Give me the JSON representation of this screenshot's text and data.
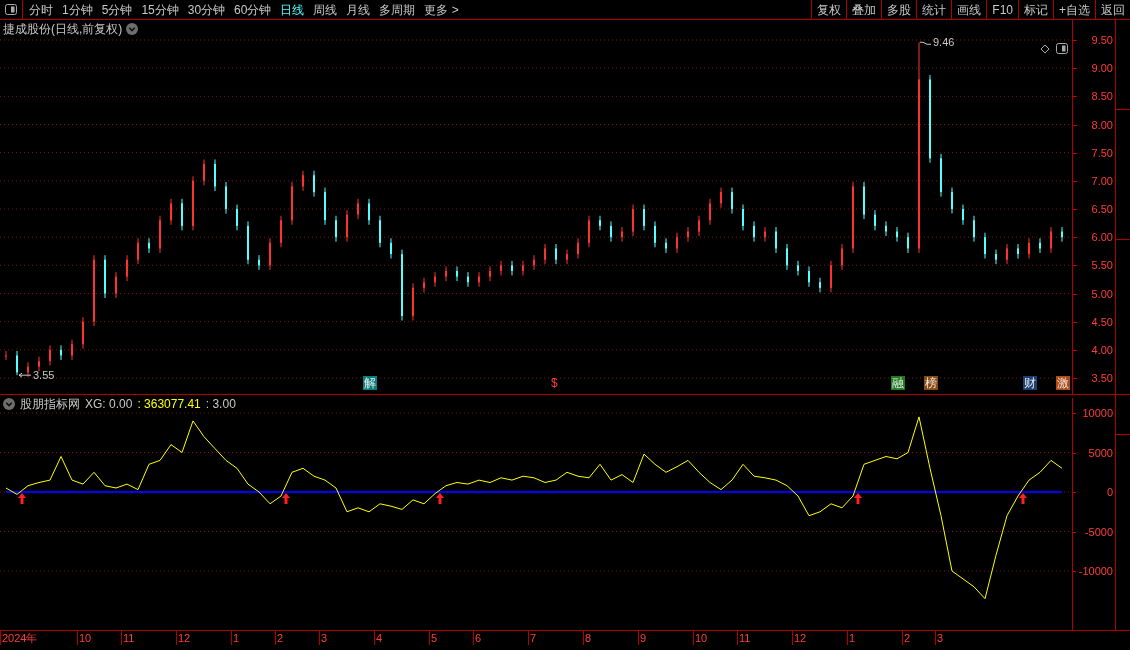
{
  "toolbar": {
    "periods": [
      {
        "label": "分时",
        "selected": false
      },
      {
        "label": "1分钟",
        "selected": false
      },
      {
        "label": "5分钟",
        "selected": false
      },
      {
        "label": "15分钟",
        "selected": false
      },
      {
        "label": "30分钟",
        "selected": false
      },
      {
        "label": "60分钟",
        "selected": false
      },
      {
        "label": "日线",
        "selected": true
      },
      {
        "label": "周线",
        "selected": false
      },
      {
        "label": "月线",
        "selected": false
      },
      {
        "label": "多周期",
        "selected": false
      },
      {
        "label": "更多 >",
        "selected": false
      }
    ],
    "actions": [
      "复权",
      "叠加",
      "多股",
      "统计",
      "画线",
      "F10",
      "标记",
      "+自选",
      "返回"
    ]
  },
  "price_panel": {
    "title": "捷成股份(日线,前复权)",
    "axis_labels": [
      "9.50",
      "9.00",
      "8.50",
      "8.00",
      "7.50",
      "7.00",
      "6.50",
      "6.00",
      "5.50",
      "5.00",
      "4.50",
      "4.00",
      "3.50"
    ],
    "low_label": "3.55",
    "high_label": "9.46",
    "events": [
      {
        "label": "解",
        "color": "#0a7d7d"
      },
      {
        "label": "$",
        "color": "#000000"
      },
      {
        "label": "融",
        "color": "#1f7a1f"
      },
      {
        "label": "榜",
        "color": "#8a4a10"
      },
      {
        "label": "财",
        "color": "#1c3f73"
      },
      {
        "label": "激",
        "color": "#b04a14"
      }
    ]
  },
  "indicator_panel": {
    "name": "股朋指标网",
    "readouts": [
      {
        "text": "XG: 0.00",
        "color": "#c8c8c8"
      },
      {
        "text": ": 363077.41",
        "color": "#ffff00"
      },
      {
        "text": ": 3.00",
        "color": "#c8c8c8"
      }
    ],
    "chart_data": {
      "type": "line",
      "grid": true,
      "ylim": [
        -17468,
        11899
      ],
      "yticks": [
        {
          "value": 10000,
          "label": "10000"
        },
        {
          "value": 5000,
          "label": "5000"
        },
        {
          "value": 0,
          "label": "0"
        },
        {
          "value": -5000,
          "label": "-5000"
        },
        {
          "value": -10000,
          "label": "-10000"
        }
      ],
      "series": [
        {
          "color": "#ffff00",
          "values": [
            500,
            -300,
            800,
            1200,
            1500,
            4500,
            1500,
            1000,
            2500,
            800,
            500,
            1000,
            300,
            3500,
            4000,
            6000,
            5000,
            9000,
            7000,
            5500,
            4000,
            3000,
            1000,
            0,
            -1500,
            -500,
            2500,
            3000,
            2000,
            1500,
            500,
            -2500,
            -2000,
            -2500,
            -1500,
            -1800,
            -2200,
            -1000,
            -1500,
            -200,
            800,
            1200,
            1000,
            1500,
            1200,
            1800,
            1500,
            2000,
            1800,
            1200,
            1500,
            2500,
            2000,
            1800,
            3500,
            1500,
            2200,
            1200,
            4800,
            3500,
            2500,
            3200,
            4000,
            2500,
            1200,
            300,
            1500,
            3500,
            2000,
            1800,
            1500,
            800,
            -500,
            -3000,
            -2500,
            -1500,
            -2000,
            -500,
            3500,
            4000,
            4500,
            4200,
            5000,
            9500,
            3000,
            -3000,
            -10000,
            -11000,
            -12000,
            -13500,
            -8000,
            -3000,
            -500,
            1500,
            2500,
            4000,
            3000
          ]
        },
        {
          "color": "#0000ff",
          "values": [
            0,
            0,
            0,
            0,
            0,
            0,
            0,
            0,
            0,
            0,
            0,
            0,
            0,
            0,
            0,
            0,
            0,
            0,
            0,
            0,
            0,
            0,
            0,
            0,
            0,
            0,
            0,
            0,
            0,
            0,
            0,
            0,
            0,
            0,
            0,
            0,
            0,
            0,
            0,
            0,
            0,
            0,
            0,
            0,
            0,
            0,
            0,
            0,
            0,
            0,
            0,
            0,
            0,
            0,
            0,
            0,
            0,
            0,
            0,
            0,
            0,
            0,
            0,
            0,
            0,
            0,
            0,
            0,
            0,
            0,
            0,
            0,
            0,
            0,
            0,
            0,
            0,
            0,
            0,
            0,
            0,
            0,
            0,
            0,
            0,
            0,
            0,
            0,
            0,
            0,
            0,
            0,
            0,
            0,
            0,
            0,
            0
          ]
        }
      ]
    }
  },
  "time_axis": [
    "2024年",
    "10",
    "11",
    "12",
    "1",
    "2",
    "3",
    "4",
    "5",
    "6",
    "7",
    "8",
    "9",
    "10",
    "11",
    "12",
    "1",
    "2",
    "3"
  ]
}
